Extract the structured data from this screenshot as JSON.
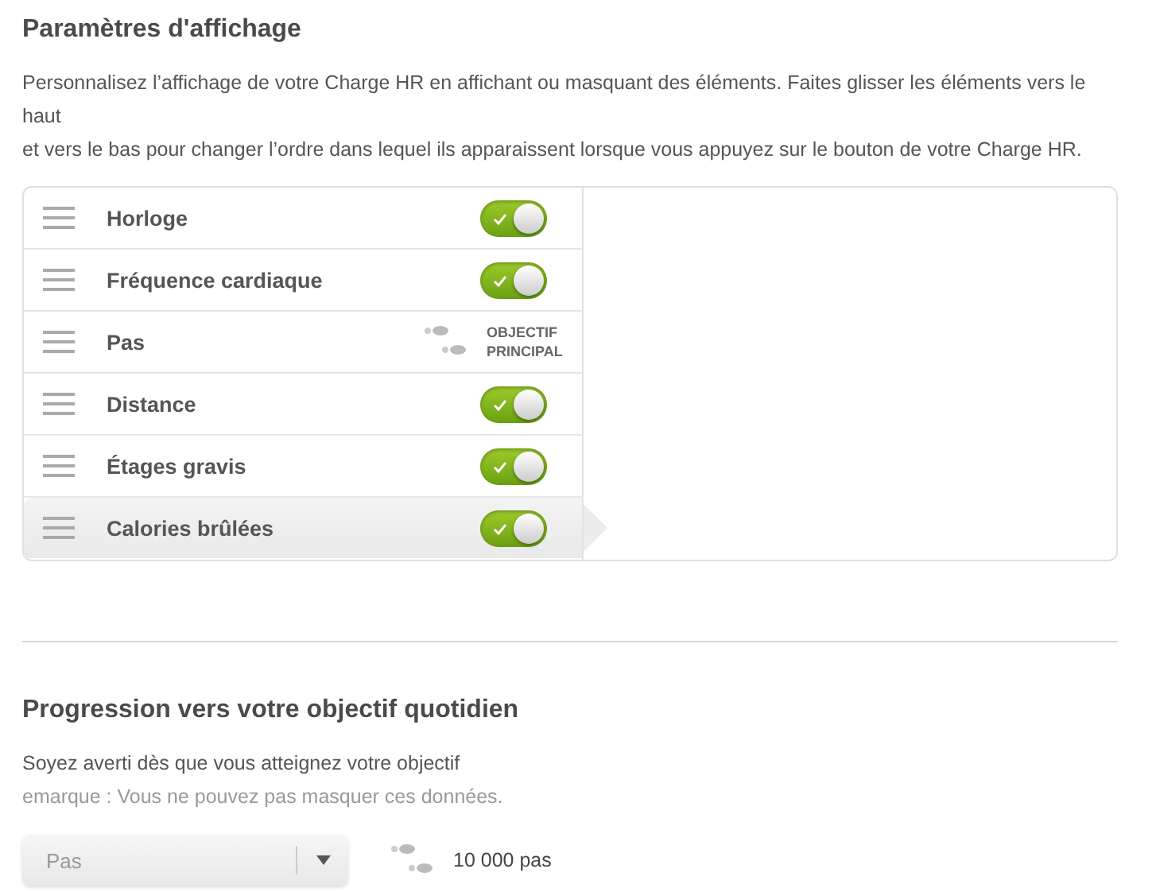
{
  "display_settings": {
    "title": "Paramètres d'affichage",
    "description": [
      "Personnalisez l’affichage de votre Charge HR en affichant ou masquant des éléments. Faites glisser les éléments vers le haut",
      "et vers le bas pour changer l’ordre dans lequel ils apparaissent lorsque vous appuyez sur le bouton de votre Charge HR."
    ],
    "items": [
      {
        "label": "Horloge",
        "kind": "toggle",
        "on": true,
        "selected": false
      },
      {
        "label": "Fréquence cardiaque",
        "kind": "toggle",
        "on": true,
        "selected": false
      },
      {
        "label": "Pas",
        "kind": "goal",
        "badge": "OBJECTIF PRINCIPAL",
        "selected": false
      },
      {
        "label": "Distance",
        "kind": "toggle",
        "on": true,
        "selected": false
      },
      {
        "label": "Étages gravis",
        "kind": "toggle",
        "on": true,
        "selected": false
      },
      {
        "label": "Calories brûlées",
        "kind": "toggle",
        "on": true,
        "selected": true
      }
    ]
  },
  "daily_goal": {
    "title": "Progression vers votre objectif quotidien",
    "description": "Soyez averti dès que vous atteignez votre objectif",
    "note": "emarque : Vous ne pouvez pas masquer ces données.",
    "select": {
      "value": "Pas"
    },
    "goal": "10 000 pas"
  }
}
